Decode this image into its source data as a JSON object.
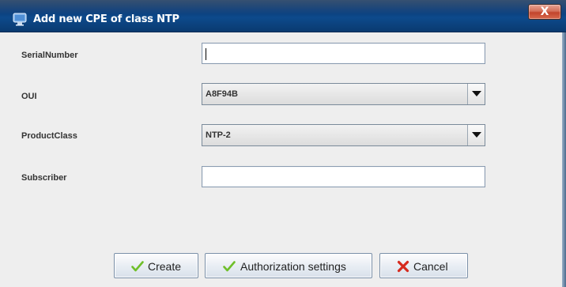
{
  "window": {
    "title": "Add new CPE of class NTP",
    "close_label": "X"
  },
  "form": {
    "serial_number": {
      "label": "SerialNumber",
      "value": ""
    },
    "oui": {
      "label": "OUI",
      "value": "A8F94B"
    },
    "product_class": {
      "label": "ProductClass",
      "value": "NTP-2"
    },
    "subscriber": {
      "label": "Subscriber",
      "value": ""
    }
  },
  "buttons": {
    "create": "Create",
    "authorization_settings": "Authorization settings",
    "cancel": "Cancel"
  },
  "colors": {
    "titlebar": "#0b3a73",
    "check_icon": "#6fbf2a",
    "cancel_icon": "#d62a1e"
  },
  "icons": {
    "app": "window-app-icon",
    "create": "check-icon",
    "authorization": "check-icon",
    "cancel": "cross-icon",
    "combo": "chevron-down-icon"
  }
}
